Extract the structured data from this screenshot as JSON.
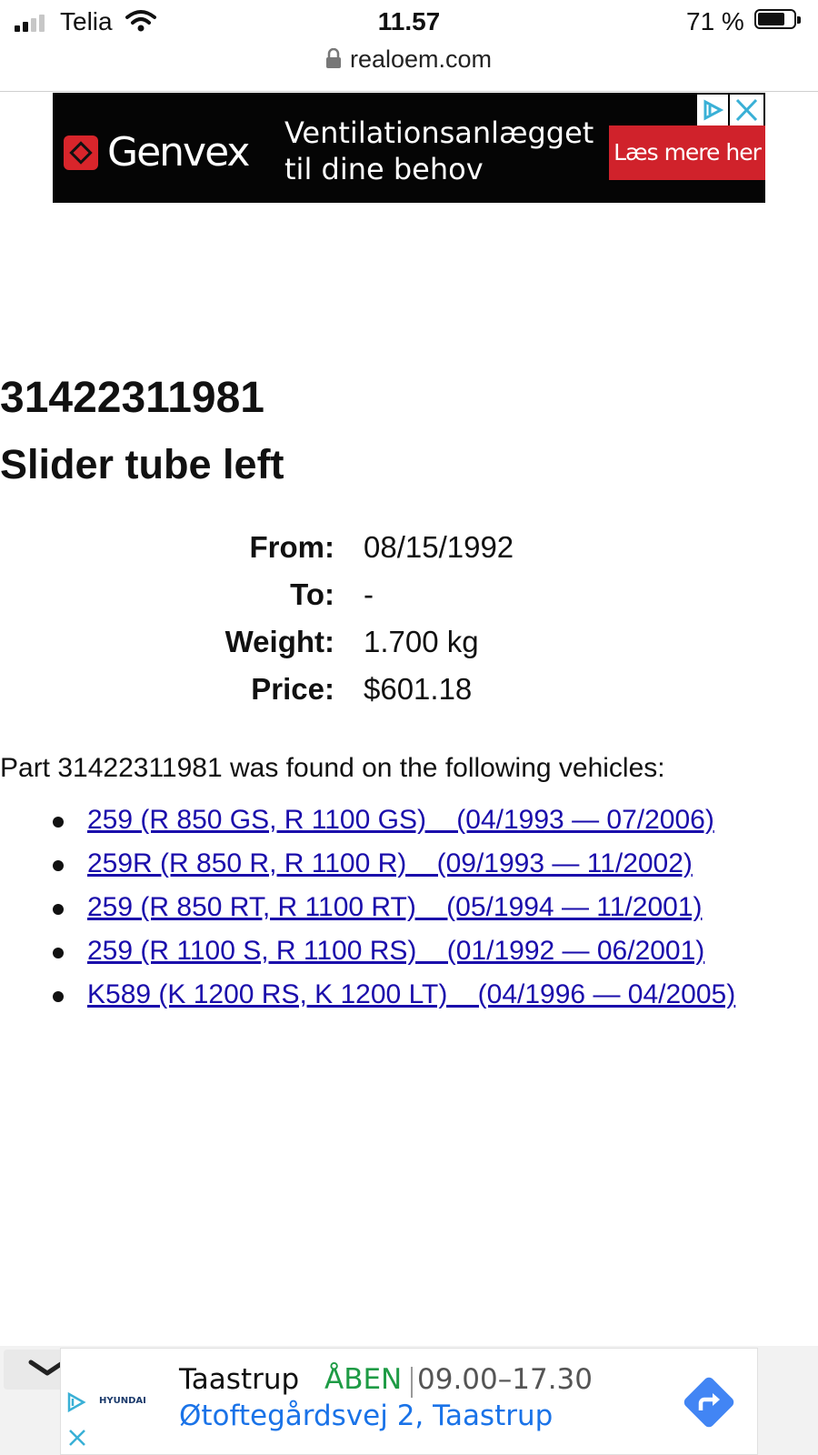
{
  "status_bar": {
    "carrier": "Telia",
    "time": "11.57",
    "battery_percent": "71 %",
    "battery_level": 0.71,
    "signal_bars": 2
  },
  "browser": {
    "url": "realoem.com"
  },
  "ad_top": {
    "brand": "Genvex",
    "headline_line1": "Ventilationsanlægget",
    "headline_line2": "til dine behov",
    "cta": "Læs mere her",
    "brand_color": "#d8252b",
    "icons": [
      "adchoices-icon",
      "close-icon"
    ]
  },
  "part": {
    "number": "31422311981",
    "name": "Slider tube left",
    "specs": [
      {
        "label": "From:",
        "value": "08/15/1992"
      },
      {
        "label": "To:",
        "value": "-"
      },
      {
        "label": "Weight:",
        "value": "1.700 kg"
      },
      {
        "label": "Price:",
        "value": "$601.18"
      }
    ],
    "found_text": "Part 31422311981 was found on the following vehicles:",
    "vehicles": [
      {
        "label": "259 (R 850 GS, R 1100 GS)    (04/1993 — 07/2006)"
      },
      {
        "label": "259R (R 850 R, R 1100 R)    (09/1993 — 11/2002)"
      },
      {
        "label": "259 (R 850 RT, R 1100 RT)    (05/1994 — 11/2001)"
      },
      {
        "label": "259 (R 1100 S, R 1100 RS)    (01/1992 — 06/2001)"
      },
      {
        "label": "K589 (K 1200 RS, K 1200 LT)    (04/1996 — 04/2005)"
      }
    ],
    "link_color": "#1a0dab"
  },
  "ad_bottom": {
    "brand": "HYUNDAI",
    "city": "Taastrup",
    "status": "ÅBEN",
    "hours": "09.00–17.30",
    "address": "Øtoftegårdsvej 2, Taastrup",
    "open_color": "#1e9b45",
    "address_color": "#1a73e8",
    "icons": [
      "chevron-down-icon",
      "adchoices-icon",
      "close-icon",
      "directions-icon"
    ]
  }
}
